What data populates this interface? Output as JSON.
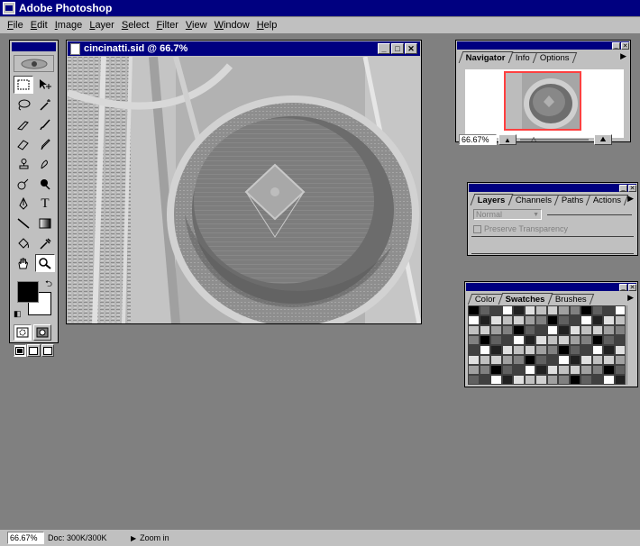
{
  "app": {
    "title": "Adobe Photoshop"
  },
  "menu": [
    "File",
    "Edit",
    "Image",
    "Layer",
    "Select",
    "Filter",
    "View",
    "Window",
    "Help"
  ],
  "document": {
    "title": "cincinatti.sid @ 66.7%",
    "window_buttons": [
      "_",
      "□",
      "✕"
    ]
  },
  "navigator": {
    "tabs": [
      "Navigator",
      "Info",
      "Options"
    ],
    "zoom": "66.67%"
  },
  "layers": {
    "tabs": [
      "Layers",
      "Channels",
      "Paths",
      "Actions"
    ],
    "blend_mode": "Normal",
    "preserve_transparency": "Preserve Transparency"
  },
  "swatches": {
    "tabs": [
      "Color",
      "Swatches",
      "Brushes"
    ]
  },
  "status": {
    "zoom": "66.67%",
    "doc": "Doc: 300K/300K",
    "hint": "Zoom in"
  }
}
